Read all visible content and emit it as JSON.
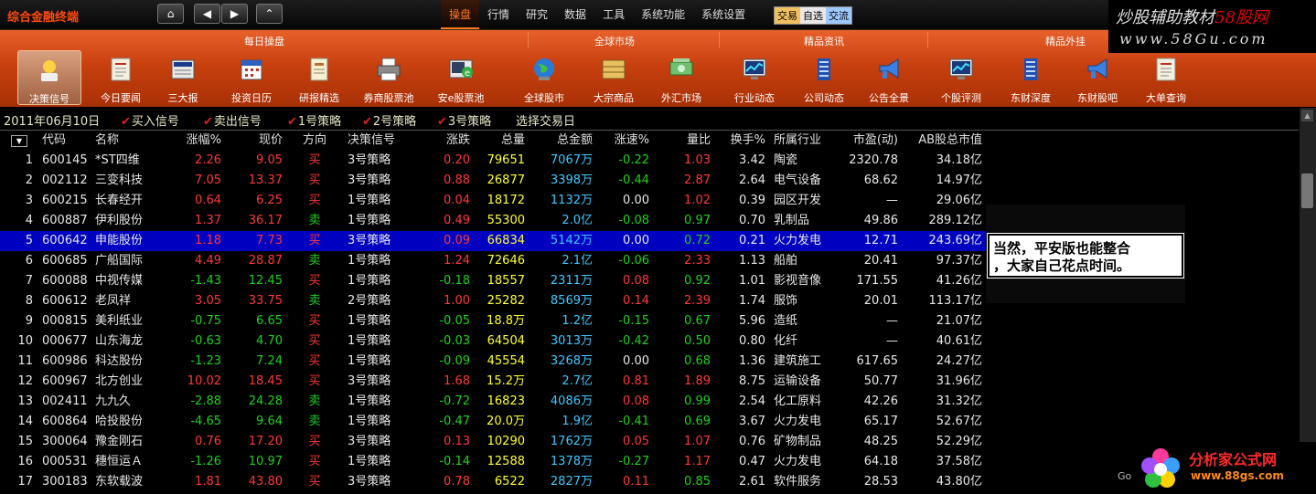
{
  "app": {
    "title": "综合金融终端"
  },
  "nav": {
    "home": "⌂",
    "prev": "◀",
    "next": "▶",
    "up": "⌃"
  },
  "menu": [
    "操盘",
    "行情",
    "研究",
    "数据",
    "工具",
    "系统功能",
    "系统设置"
  ],
  "mode_buttons": [
    "交易",
    "自选",
    "交流"
  ],
  "watermark": {
    "title_prefix": "炒股辅助教材",
    "title_red": "58股网",
    "url": "www.58Gu.com"
  },
  "toolbar": {
    "sections": [
      "每日操盘",
      "全球市场",
      "精品资讯",
      "精品外挂"
    ],
    "buttons": [
      {
        "label": "决策信号",
        "icon": "signal-icon"
      },
      {
        "label": "今日要闻",
        "icon": "news-icon"
      },
      {
        "label": "三大报",
        "icon": "newspaper-icon"
      },
      {
        "label": "投资日历",
        "icon": "calendar-icon"
      },
      {
        "label": "研报精选",
        "icon": "report-icon"
      },
      {
        "label": "券商股票池",
        "icon": "printer-icon"
      },
      {
        "label": "安e股票池",
        "icon": "e-stock-icon"
      },
      {
        "label": "全球股市",
        "icon": "globe-icon"
      },
      {
        "label": "大宗商品",
        "icon": "commodity-icon"
      },
      {
        "label": "外汇市场",
        "icon": "money-icon"
      },
      {
        "label": "行业动态",
        "icon": "monitor-chart-icon"
      },
      {
        "label": "公司动态",
        "icon": "building-icon"
      },
      {
        "label": "公告全景",
        "icon": "megaphone-icon"
      },
      {
        "label": "个股评测",
        "icon": "monitor-chart-icon"
      },
      {
        "label": "东财深度",
        "icon": "building-icon"
      },
      {
        "label": "东财股吧",
        "icon": "megaphone-icon"
      },
      {
        "label": "大单查询",
        "icon": "news-icon"
      }
    ]
  },
  "filters": {
    "date": "2011年06月10日",
    "items": [
      "买入信号",
      "卖出信号",
      "1号策略",
      "2号策略",
      "3号策略"
    ],
    "select": "选择交易日"
  },
  "table": {
    "columns": [
      "代码",
      "名称",
      "涨幅%",
      "现价",
      "方向",
      "决策信号",
      "涨跌",
      "总量",
      "总金额",
      "涨速%",
      "量比",
      "换手%",
      "所属行业",
      "市盈(动)",
      "AB股总市值"
    ],
    "selected_row": 5,
    "rows": [
      {
        "no": "1",
        "code": "600145",
        "name": "*ST四维",
        "pct": "2.26",
        "price": "9.05",
        "dir": "买",
        "signal": "3号策略",
        "chg": "0.20",
        "vol": "79651",
        "amt": "7067万",
        "spd": "-0.22",
        "vr": "1.03",
        "turn": "3.42",
        "ind": "陶瓷",
        "pe": "2320.78",
        "mcap": "34.18亿"
      },
      {
        "no": "2",
        "code": "002112",
        "name": "三变科技",
        "pct": "7.05",
        "price": "13.37",
        "dir": "买",
        "signal": "3号策略",
        "chg": "0.88",
        "vol": "26877",
        "amt": "3398万",
        "spd": "-0.44",
        "vr": "2.87",
        "turn": "2.64",
        "ind": "电气设备",
        "pe": "68.62",
        "mcap": "14.97亿"
      },
      {
        "no": "3",
        "code": "600215",
        "name": "长春经开",
        "pct": "0.64",
        "price": "6.25",
        "dir": "买",
        "signal": "1号策略",
        "chg": "0.04",
        "vol": "18172",
        "amt": "1132万",
        "spd": "0.00",
        "vr": "1.02",
        "turn": "0.39",
        "ind": "园区开发",
        "pe": "—",
        "mcap": "29.06亿"
      },
      {
        "no": "4",
        "code": "600887",
        "name": "伊利股份",
        "pct": "1.37",
        "price": "36.17",
        "dir": "卖",
        "signal": "1号策略",
        "chg": "0.49",
        "vol": "55300",
        "amt": "2.0亿",
        "spd": "-0.08",
        "vr": "0.97",
        "turn": "0.70",
        "ind": "乳制品",
        "pe": "49.86",
        "mcap": "289.12亿"
      },
      {
        "no": "5",
        "code": "600642",
        "name": "申能股份",
        "pct": "1.18",
        "price": "7.73",
        "dir": "买",
        "signal": "3号策略",
        "chg": "0.09",
        "vol": "66834",
        "amt": "5142万",
        "spd": "0.00",
        "vr": "0.72",
        "turn": "0.21",
        "ind": "火力发电",
        "pe": "12.71",
        "mcap": "243.69亿"
      },
      {
        "no": "6",
        "code": "600685",
        "name": "广船国际",
        "pct": "4.49",
        "price": "28.87",
        "dir": "卖",
        "signal": "1号策略",
        "chg": "1.24",
        "vol": "72646",
        "amt": "2.1亿",
        "spd": "-0.06",
        "vr": "2.33",
        "turn": "1.13",
        "ind": "船舶",
        "pe": "20.41",
        "mcap": "97.37亿"
      },
      {
        "no": "7",
        "code": "600088",
        "name": "中视传媒",
        "pct": "-1.43",
        "price": "12.45",
        "dir": "买",
        "signal": "1号策略",
        "chg": "-0.18",
        "vol": "18557",
        "amt": "2311万",
        "spd": "0.08",
        "vr": "0.92",
        "turn": "1.01",
        "ind": "影视音像",
        "pe": "171.55",
        "mcap": "41.26亿"
      },
      {
        "no": "8",
        "code": "600612",
        "name": "老凤祥",
        "pct": "3.05",
        "price": "33.75",
        "dir": "卖",
        "signal": "2号策略",
        "chg": "1.00",
        "vol": "25282",
        "amt": "8569万",
        "spd": "0.14",
        "vr": "2.39",
        "turn": "1.74",
        "ind": "服饰",
        "pe": "20.01",
        "mcap": "113.17亿"
      },
      {
        "no": "9",
        "code": "000815",
        "name": "美利纸业",
        "pct": "-0.75",
        "price": "6.65",
        "dir": "买",
        "signal": "1号策略",
        "chg": "-0.05",
        "vol": "18.8万",
        "amt": "1.2亿",
        "spd": "-0.15",
        "vr": "0.67",
        "turn": "5.96",
        "ind": "造纸",
        "pe": "—",
        "mcap": "21.07亿"
      },
      {
        "no": "10",
        "code": "000677",
        "name": "山东海龙",
        "pct": "-0.63",
        "price": "4.70",
        "dir": "买",
        "signal": "1号策略",
        "chg": "-0.03",
        "vol": "64504",
        "amt": "3013万",
        "spd": "-0.42",
        "vr": "0.50",
        "turn": "0.80",
        "ind": "化纤",
        "pe": "—",
        "mcap": "40.61亿"
      },
      {
        "no": "11",
        "code": "600986",
        "name": "科达股份",
        "pct": "-1.23",
        "price": "7.24",
        "dir": "买",
        "signal": "1号策略",
        "chg": "-0.09",
        "vol": "45554",
        "amt": "3268万",
        "spd": "0.00",
        "vr": "0.68",
        "turn": "1.36",
        "ind": "建筑施工",
        "pe": "617.65",
        "mcap": "24.27亿"
      },
      {
        "no": "12",
        "code": "600967",
        "name": "北方创业",
        "pct": "10.02",
        "price": "18.45",
        "dir": "买",
        "signal": "3号策略",
        "chg": "1.68",
        "vol": "15.2万",
        "amt": "2.7亿",
        "spd": "0.81",
        "vr": "1.89",
        "turn": "8.75",
        "ind": "运输设备",
        "pe": "50.77",
        "mcap": "31.96亿"
      },
      {
        "no": "13",
        "code": "002411",
        "name": "九九久",
        "pct": "-2.88",
        "price": "24.28",
        "dir": "卖",
        "signal": "1号策略",
        "chg": "-0.72",
        "vol": "16823",
        "amt": "4086万",
        "spd": "0.08",
        "vr": "0.99",
        "turn": "2.54",
        "ind": "化工原料",
        "pe": "42.26",
        "mcap": "31.32亿"
      },
      {
        "no": "14",
        "code": "600864",
        "name": "哈投股份",
        "pct": "-4.65",
        "price": "9.64",
        "dir": "卖",
        "signal": "1号策略",
        "chg": "-0.47",
        "vol": "20.0万",
        "amt": "1.9亿",
        "spd": "-0.41",
        "vr": "0.69",
        "turn": "3.67",
        "ind": "火力发电",
        "pe": "65.17",
        "mcap": "52.67亿"
      },
      {
        "no": "15",
        "code": "300064",
        "name": "豫金刚石",
        "pct": "0.76",
        "price": "17.20",
        "dir": "买",
        "signal": "3号策略",
        "chg": "0.13",
        "vol": "10290",
        "amt": "1762万",
        "spd": "0.05",
        "vr": "1.07",
        "turn": "0.76",
        "ind": "矿物制品",
        "pe": "48.25",
        "mcap": "52.29亿"
      },
      {
        "no": "16",
        "code": "000531",
        "name": "穗恒运Ａ",
        "pct": "-1.26",
        "price": "10.97",
        "dir": "买",
        "signal": "1号策略",
        "chg": "-0.14",
        "vol": "12588",
        "amt": "1378万",
        "spd": "-0.27",
        "vr": "1.17",
        "turn": "0.47",
        "ind": "火力发电",
        "pe": "64.18",
        "mcap": "37.58亿"
      },
      {
        "no": "17",
        "code": "300183",
        "name": "东软载波",
        "pct": "1.81",
        "price": "43.80",
        "dir": "买",
        "signal": "3号策略",
        "chg": "0.78",
        "vol": "6522",
        "amt": "2827万",
        "spd": "0.11",
        "vr": "0.85",
        "turn": "2.61",
        "ind": "软件服务",
        "pe": "28.53",
        "mcap": "43.80亿"
      }
    ]
  },
  "callout": {
    "line1": "当然，平安版也能整合",
    "line2": "，大家自己花点时间。"
  },
  "logo": {
    "name": "分析家公式网",
    "url": "www.88gs.com",
    "frag": "Go"
  },
  "colors": {
    "up": "#ff3838",
    "down": "#20d020",
    "selected_row": "#0000c0",
    "toolbar": "#c8400e"
  }
}
